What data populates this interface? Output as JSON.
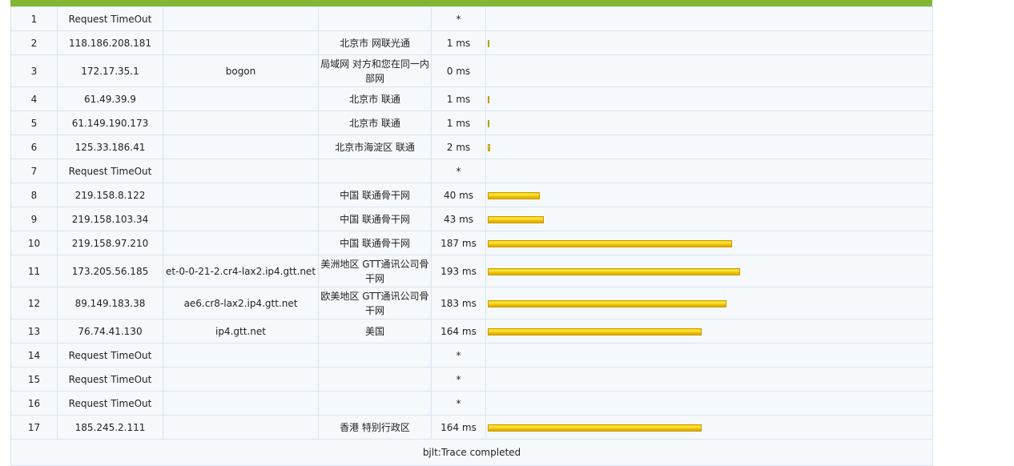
{
  "hops": [
    {
      "n": "1",
      "ip": "Request TimeOut",
      "host": "",
      "loc": "",
      "ms": "*",
      "latency": 0
    },
    {
      "n": "2",
      "ip": "118.186.208.181",
      "host": "",
      "loc": "北京市 网联光通",
      "ms": "1 ms",
      "latency": 1
    },
    {
      "n": "3",
      "ip": "172.17.35.1",
      "host": "bogon",
      "loc": "局域网 对方和您在同一内部网",
      "ms": "0 ms",
      "latency": 0
    },
    {
      "n": "4",
      "ip": "61.49.39.9",
      "host": "",
      "loc": "北京市 联通",
      "ms": "1 ms",
      "latency": 1
    },
    {
      "n": "5",
      "ip": "61.149.190.173",
      "host": "",
      "loc": "北京市 联通",
      "ms": "1 ms",
      "latency": 1
    },
    {
      "n": "6",
      "ip": "125.33.186.41",
      "host": "",
      "loc": "北京市海淀区 联通",
      "ms": "2 ms",
      "latency": 2
    },
    {
      "n": "7",
      "ip": "Request TimeOut",
      "host": "",
      "loc": "",
      "ms": "*",
      "latency": 0
    },
    {
      "n": "8",
      "ip": "219.158.8.122",
      "host": "",
      "loc": "中国 联通骨干网",
      "ms": "40 ms",
      "latency": 40
    },
    {
      "n": "9",
      "ip": "219.158.103.34",
      "host": "",
      "loc": "中国 联通骨干网",
      "ms": "43 ms",
      "latency": 43
    },
    {
      "n": "10",
      "ip": "219.158.97.210",
      "host": "",
      "loc": "中国 联通骨干网",
      "ms": "187 ms",
      "latency": 187
    },
    {
      "n": "11",
      "ip": "173.205.56.185",
      "host": "et-0-0-21-2.cr4-lax2.ip4.gtt.net",
      "loc": "美洲地区 GTT通讯公司骨干网",
      "ms": "193 ms",
      "latency": 193
    },
    {
      "n": "12",
      "ip": "89.149.183.38",
      "host": "ae6.cr8-lax2.ip4.gtt.net",
      "loc": "欧美地区 GTT通讯公司骨干网",
      "ms": "183 ms",
      "latency": 183
    },
    {
      "n": "13",
      "ip": "76.74.41.130",
      "host": "ip4.gtt.net",
      "loc": "美国",
      "ms": "164 ms",
      "latency": 164
    },
    {
      "n": "14",
      "ip": "Request TimeOut",
      "host": "",
      "loc": "",
      "ms": "*",
      "latency": 0
    },
    {
      "n": "15",
      "ip": "Request TimeOut",
      "host": "",
      "loc": "",
      "ms": "*",
      "latency": 0
    },
    {
      "n": "16",
      "ip": "Request TimeOut",
      "host": "",
      "loc": "",
      "ms": "*",
      "latency": 0
    },
    {
      "n": "17",
      "ip": "185.245.2.111",
      "host": "",
      "loc": "香港 特别行政区",
      "ms": "164 ms",
      "latency": 164
    }
  ],
  "footer": "bjlt:Trace completed",
  "colors": {
    "header_bar": "#80b834",
    "latency_bar": "#f8d700",
    "row_bg": "#f5f9fb",
    "border": "#dde3f0"
  }
}
